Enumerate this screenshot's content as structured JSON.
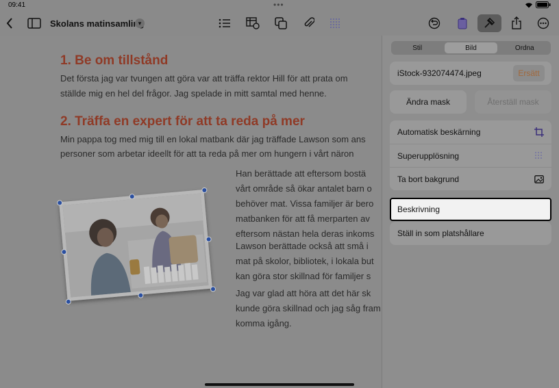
{
  "status_bar": {
    "time": "09:41",
    "dots": "•••",
    "battery": "100%"
  },
  "toolbar": {
    "doc_title": "Skolans matinsamling",
    "icons": [
      "back-icon",
      "sidebar-icon",
      "list-icon",
      "table-icon",
      "shape-icon",
      "attachment-icon",
      "grid-icon",
      "undo-icon",
      "paste-icon",
      "format-icon",
      "share-icon",
      "more-icon"
    ]
  },
  "document": {
    "heading1": "1.   Be om tillstånd",
    "para1_line1": "Det första jag var tvungen att göra var att träffa rektor Hill för att prata om",
    "para1_line2": "ställde mig en hel del frågor. Jag spelade in mitt samtal med henne.",
    "heading2": "2.   Träffa en expert för att ta reda på mer",
    "para2_line1": "Min pappa tog med mig till en lokal matbank där jag träffade Lawson som ans",
    "para2_line2": "personer som arbetar ideellt för att ta reda på mer om hungern i vårt näron",
    "col_p1": [
      "Han berättade att eftersom bostä",
      "vårt område så ökar antalet barn o",
      "behöver mat. Vissa familjer är bero",
      "matbanken för att få merparten av",
      "eftersom nästan hela deras inkoms"
    ],
    "col_p2": [
      " Lawson berättade också att små i",
      "mat på skolor, bibliotek, i lokala but",
      "kan göra stor skillnad för familjer s"
    ],
    "col_p3": [
      "Jag var glad att höra att det här sk",
      "kunde göra skillnad och jag såg fram",
      "komma igång."
    ]
  },
  "panel": {
    "tabs": [
      "Stil",
      "Bild",
      "Ordna"
    ],
    "selected_tab": "Bild",
    "file_name": "iStock-932074474.jpeg",
    "replace_label": "Ersätt",
    "edit_mask_label": "Ändra mask",
    "reset_mask_label": "Återställ mask",
    "options": [
      {
        "label": "Automatisk beskärning",
        "icon": "crop-icon"
      },
      {
        "label": "Superupplösning",
        "icon": "resolution-icon"
      },
      {
        "label": "Ta bort bakgrund",
        "icon": "remove-background-icon"
      }
    ],
    "description_label": "Beskrivning",
    "placeholder_label": "Ställ in som platshållare"
  },
  "colors": {
    "heading": "#8f3a26",
    "accent": "#c07a3a",
    "highlight_border": "#000000"
  }
}
